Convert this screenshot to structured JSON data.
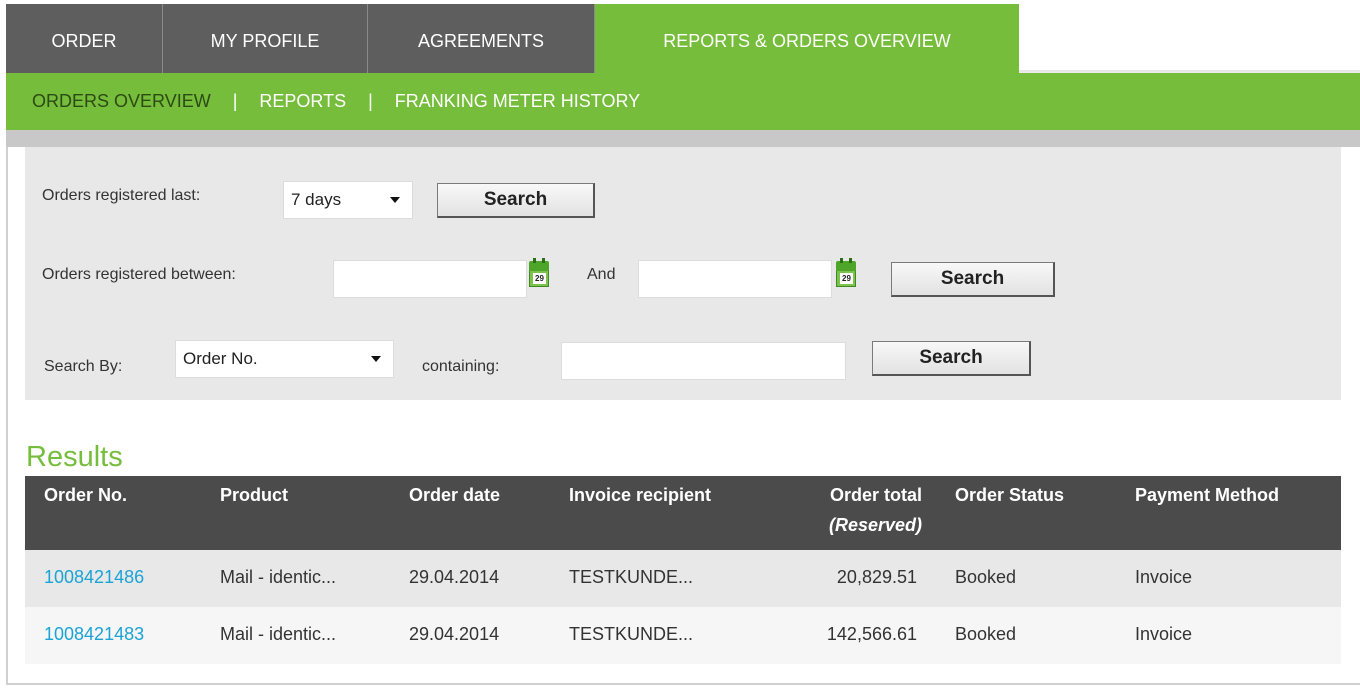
{
  "tabs": [
    {
      "label": "ORDER"
    },
    {
      "label": "MY PROFILE"
    },
    {
      "label": "AGREEMENTS"
    },
    {
      "label": "REPORTS & ORDERS OVERVIEW",
      "active": true
    }
  ],
  "subnav": {
    "items": [
      {
        "label": "ORDERS OVERVIEW"
      },
      {
        "label": "REPORTS"
      },
      {
        "label": "FRANKING METER HISTORY"
      }
    ],
    "separator": "|"
  },
  "search": {
    "last_label": "Orders registered last:",
    "last_value": "7 days",
    "between_label": "Orders registered between:",
    "from_value": "",
    "and_label": "And",
    "to_value": "",
    "calendar_day": "29",
    "by_label": "Search By:",
    "by_value": "Order No.",
    "containing_label": "containing:",
    "containing_value": "",
    "button_label": "Search"
  },
  "results": {
    "title": "Results",
    "columns": {
      "order_no": "Order No.",
      "product": "Product",
      "order_date": "Order date",
      "invoice_recipient": "Invoice recipient",
      "order_total": "Order total",
      "order_total_note": "(Reserved)",
      "order_status": "Order Status",
      "payment_method": "Payment Method"
    },
    "rows": [
      {
        "order_no": "1008421486",
        "product": "Mail - identic...",
        "order_date": "29.04.2014",
        "invoice_recipient": "TESTKUNDE...",
        "order_total": "20,829.51",
        "order_status": "Booked",
        "payment_method": "Invoice"
      },
      {
        "order_no": "1008421483",
        "product": "Mail - identic...",
        "order_date": "29.04.2014",
        "invoice_recipient": "TESTKUNDE...",
        "order_total": "142,566.61",
        "order_status": "Booked",
        "payment_method": "Invoice"
      }
    ]
  },
  "colors": {
    "brand_green": "#76bd3b",
    "tab_gray": "#5e5e5e",
    "header_dark": "#4b4b4b",
    "link_blue": "#1aa3d6"
  }
}
